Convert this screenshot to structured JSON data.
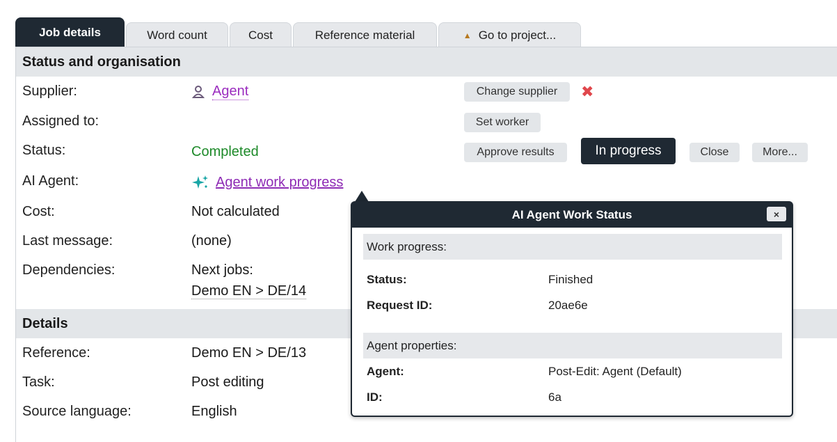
{
  "tabs": [
    {
      "label": "Job details",
      "active": true
    },
    {
      "label": "Word count"
    },
    {
      "label": "Cost"
    },
    {
      "label": "Reference material"
    },
    {
      "label": "Go to project...",
      "icon": "up-arrow-icon"
    }
  ],
  "status_section": {
    "title": "Status and organisation",
    "supplier_label": "Supplier:",
    "supplier_value": "Agent",
    "assigned_label": "Assigned to:",
    "status_label": "Status:",
    "status_value": "Completed",
    "ai_agent_label": "AI Agent:",
    "ai_agent_value": "Agent work progress",
    "cost_label": "Cost:",
    "cost_value": "Not calculated",
    "last_message_label": "Last message:",
    "last_message_value": "(none)",
    "dependencies_label": "Dependencies:",
    "dependencies_value_line1": "Next jobs:",
    "dependencies_value_line2": "Demo EN > DE/14"
  },
  "buttons": {
    "change_supplier": "Change supplier",
    "set_worker": "Set worker",
    "approve_results": "Approve results",
    "in_progress": "In progress",
    "close": "Close",
    "more": "More..."
  },
  "details_section": {
    "title": "Details",
    "reference_label": "Reference:",
    "reference_value": "Demo EN > DE/13",
    "task_label": "Task:",
    "task_value": "Post editing",
    "source_language_label": "Source language:",
    "source_language_value": "English"
  },
  "popup": {
    "title": "AI Agent Work Status",
    "close_symbol": "×",
    "work_progress_heading": "Work progress:",
    "status_label": "Status:",
    "status_value": "Finished",
    "request_id_label": "Request ID:",
    "request_id_value": "20ae6e",
    "agent_properties_heading": "Agent properties:",
    "agent_label": "Agent:",
    "agent_value": "Post-Edit: Agent (Default)",
    "id_label": "ID:",
    "id_value": "6a"
  },
  "colors": {
    "dark": "#1f2933",
    "link_purple": "#9b2dbf",
    "status_green": "#1e8a2a",
    "delete_red": "#e0474c"
  }
}
